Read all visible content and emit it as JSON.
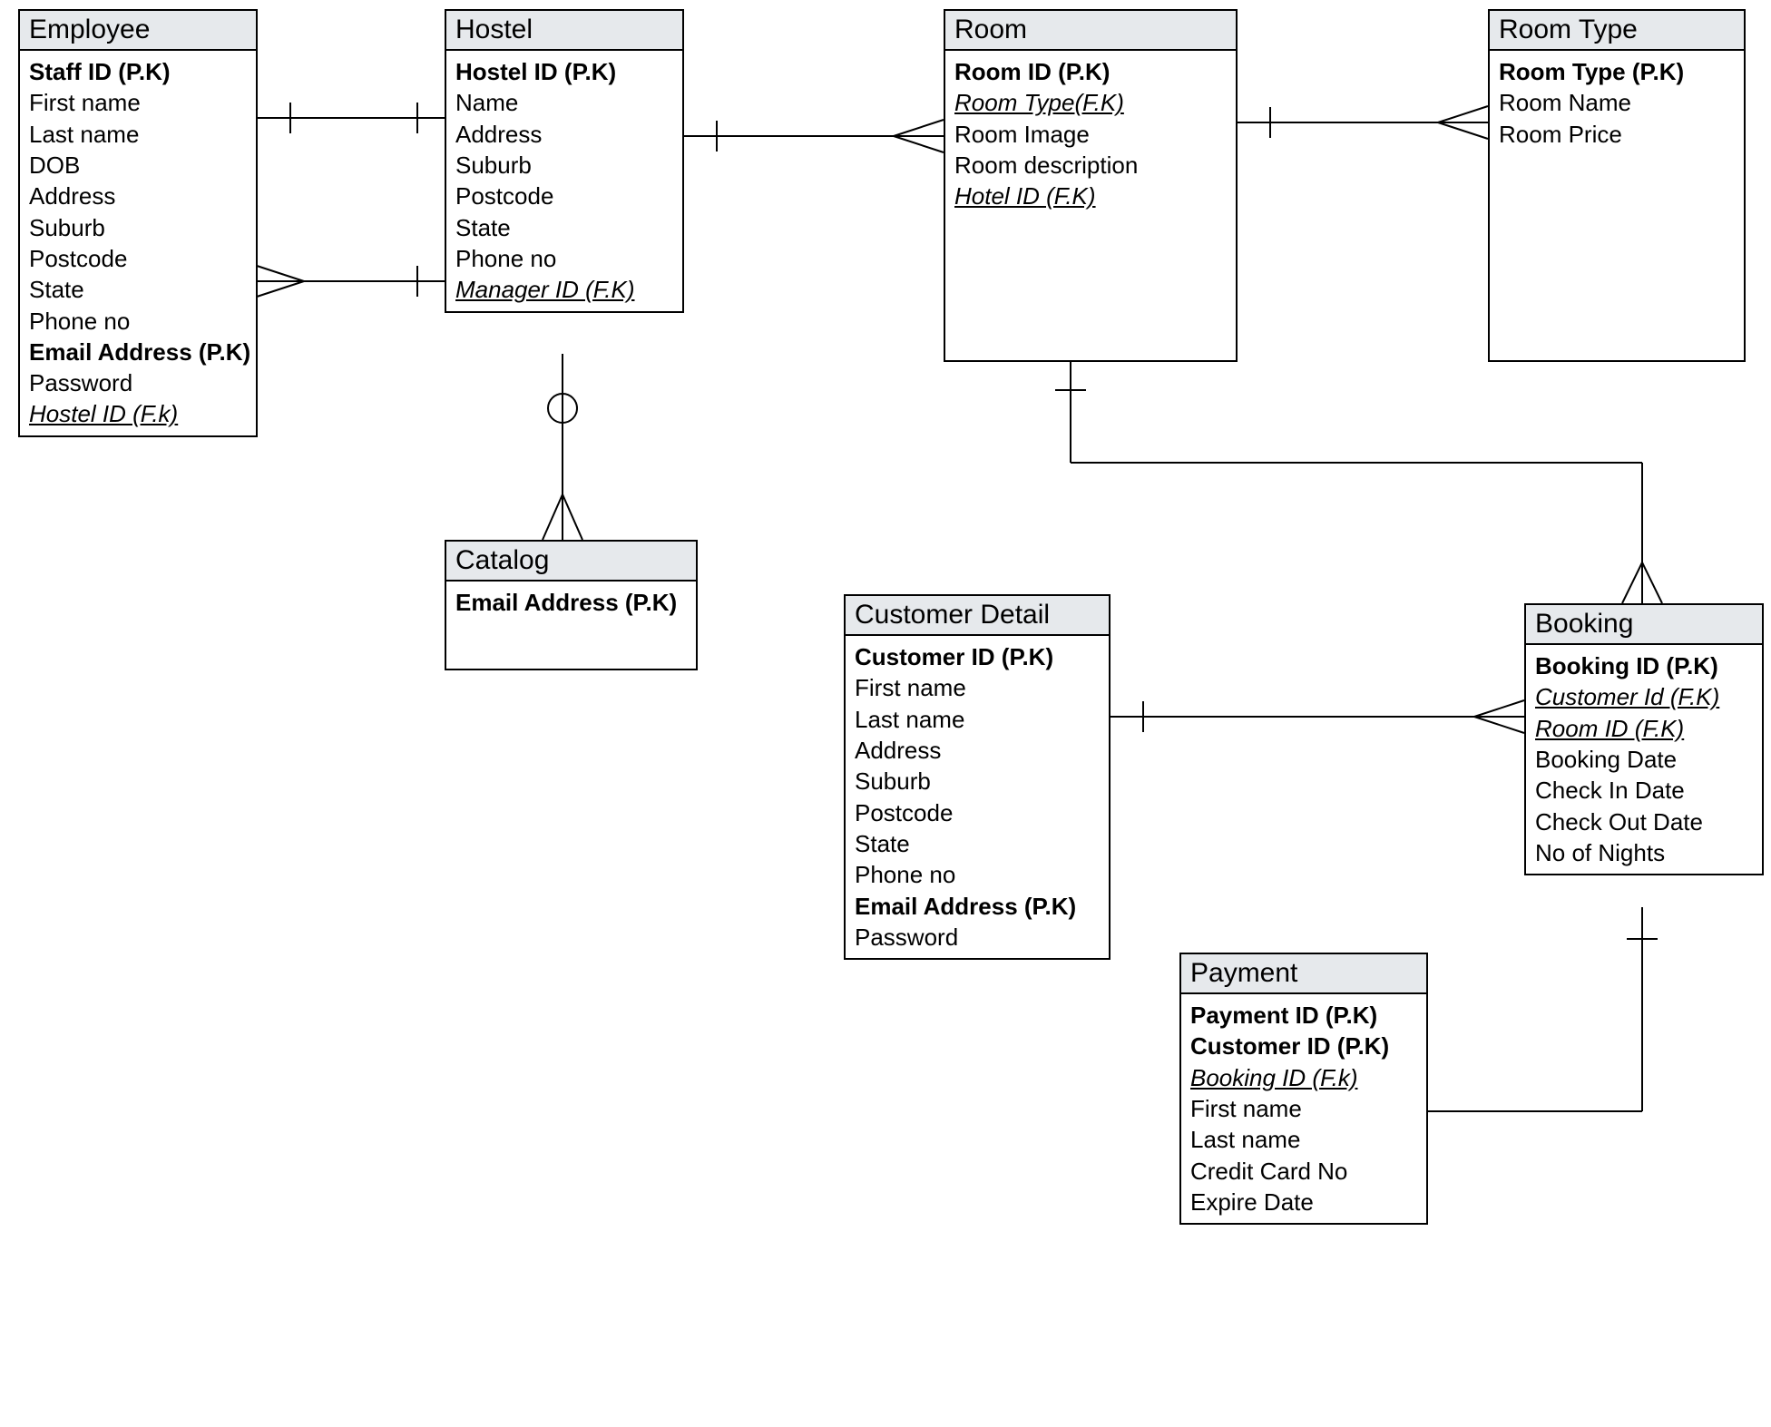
{
  "entities": {
    "employee": {
      "title": "Employee",
      "fields": [
        {
          "t": "Staff ID (P.K)",
          "pk": true
        },
        {
          "t": "First name"
        },
        {
          "t": "Last name"
        },
        {
          "t": "DOB"
        },
        {
          "t": "Address"
        },
        {
          "t": "Suburb"
        },
        {
          "t": "Postcode"
        },
        {
          "t": "State"
        },
        {
          "t": "Phone no"
        },
        {
          "t": "Email Address (P.K)",
          "pk": true
        },
        {
          "t": "Password"
        },
        {
          "t": "Hostel ID (F.k)",
          "fk": true
        }
      ]
    },
    "hostel": {
      "title": "Hostel",
      "fields": [
        {
          "t": "Hostel ID (P.K)",
          "pk": true
        },
        {
          "t": "Name"
        },
        {
          "t": "Address"
        },
        {
          "t": "Suburb"
        },
        {
          "t": "Postcode"
        },
        {
          "t": "State"
        },
        {
          "t": "Phone no"
        },
        {
          "t": "Manager ID (F.K)",
          "fk": true
        }
      ]
    },
    "catalog": {
      "title": "Catalog",
      "fields": [
        {
          "t": "Email Address (P.K)",
          "pk": true
        }
      ]
    },
    "room": {
      "title": "Room",
      "fields": [
        {
          "t": "Room ID (P.K)",
          "pk": true
        },
        {
          "t": "Room Type(F.K)",
          "fk": true
        },
        {
          "t": "Room Image"
        },
        {
          "t": "Room description"
        },
        {
          "t": "Hotel  ID (F.K)",
          "fk": true
        }
      ]
    },
    "roomtype": {
      "title": "Room Type",
      "fields": [
        {
          "t": "Room Type (P.K)",
          "pk": true
        },
        {
          "t": "Room Name"
        },
        {
          "t": "Room Price"
        }
      ]
    },
    "customer": {
      "title": "Customer Detail",
      "fields": [
        {
          "t": "Customer ID (P.K)",
          "pk": true
        },
        {
          "t": "First name"
        },
        {
          "t": "Last name"
        },
        {
          "t": "Address"
        },
        {
          "t": "Suburb"
        },
        {
          "t": "Postcode"
        },
        {
          "t": "State"
        },
        {
          "t": "Phone no"
        },
        {
          "t": "Email Address (P.K)",
          "pk": true
        },
        {
          "t": "Password"
        }
      ]
    },
    "booking": {
      "title": "Booking",
      "fields": [
        {
          "t": "Booking ID (P.K)",
          "pk": true
        },
        {
          "t": "Customer Id (F.K)",
          "fk": true
        },
        {
          "t": "Room ID (F.K)",
          "fk": true
        },
        {
          "t": "Booking Date"
        },
        {
          "t": "Check In Date"
        },
        {
          "t": "Check Out Date"
        },
        {
          "t": "No of Nights"
        }
      ]
    },
    "payment": {
      "title": "Payment",
      "fields": [
        {
          "t": "Payment ID (P.K)",
          "pk": true
        },
        {
          "t": "Customer ID (P.K)",
          "pk": true
        },
        {
          "t": "Booking ID (F.k)",
          "fk": true
        },
        {
          "t": "First name"
        },
        {
          "t": "Last name"
        },
        {
          "t": "Credit Card No"
        },
        {
          "t": "Expire Date"
        }
      ]
    }
  }
}
